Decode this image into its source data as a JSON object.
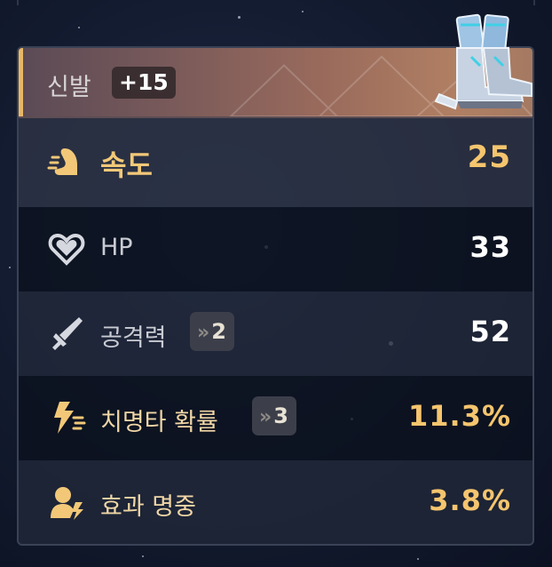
{
  "item": {
    "slot_name": "신발",
    "enhance_level": "+15",
    "icon": "boots-icon"
  },
  "main_stat": {
    "label": "속도",
    "value": "25",
    "icon": "speed-icon"
  },
  "sub_stats": [
    {
      "label": "HP",
      "value": "33",
      "icon": "heart-icon",
      "rolls": null,
      "highlighted": false
    },
    {
      "label": "공격력",
      "value": "52",
      "icon": "sword-icon",
      "rolls": "2",
      "highlighted": false
    },
    {
      "label": "치명타 확률",
      "value": "11.3%",
      "icon": "critical-icon",
      "rolls": "3",
      "highlighted": true
    },
    {
      "label": "효과 명중",
      "value": "3.8%",
      "icon": "effectiveness-icon",
      "rolls": null,
      "highlighted": true
    }
  ],
  "colors": {
    "gold": "#f5c56e",
    "white": "#ffffff",
    "header_accent": "#e9b766",
    "background": "#121a2e"
  }
}
